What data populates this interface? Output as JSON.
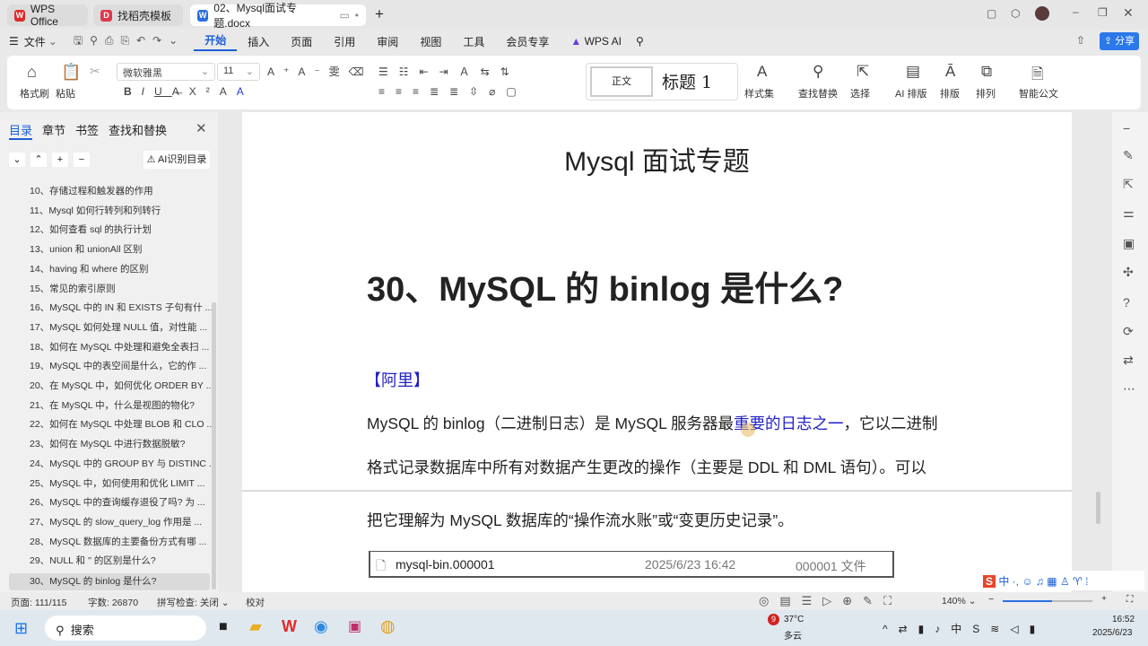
{
  "tabs": [
    {
      "label": "WPS Office"
    },
    {
      "label": "找稻壳模板"
    },
    {
      "label": "02、Mysql面试专题.docx"
    }
  ],
  "menu": {
    "file": "文件",
    "items": [
      "开始",
      "插入",
      "页面",
      "引用",
      "审阅",
      "视图",
      "工具",
      "会员专享",
      "WPS AI"
    ],
    "share": "分享"
  },
  "ribbon": {
    "format_painter": "格式刷",
    "paste": "粘贴",
    "font": "微软雅黑",
    "size": "11",
    "style_normal": "正文",
    "style_h1": "标题 1",
    "style_set": "样式集",
    "find_replace": "查找替换",
    "select": "选择",
    "ai_layout": "AI 排版",
    "layout": "排版",
    "arrange": "排列",
    "smart_doc": "智能公文"
  },
  "sidepane": {
    "tabs": [
      "目录",
      "章节",
      "书签",
      "查找和替换"
    ],
    "ai_toc": "AI识别目录",
    "items": [
      "10、存储过程和触发器的作用",
      "11、Mysql 如何行转列和列转行",
      "12、如何查看  sql  的执行计划",
      "13、union  和  unionAll  区别",
      "14、having 和 where 的区别",
      "15、常见的索引原则",
      "16、MySQL 中的 IN 和 EXISTS 子句有什 ...",
      "17、MySQL 如何处理 NULL 值，对性能 ...",
      "18、如何在 MySQL 中处理和避免全表扫 ...",
      "19、MySQL 中的表空间是什么，它的作 ...",
      "20、在 MySQL 中，如何优化 ORDER BY ...",
      "21、在 MySQL 中，什么是视图的物化?",
      "22、如何在 MySQL 中处理 BLOB 和 CLO ...",
      "23、如何在 MySQL 中进行数据脱敏?",
      "24、MySQL 中的 GROUP BY 与 DISTINC ...",
      "25、MySQL 中，如何使用和优化 LIMIT ...",
      "26、MySQL 中的查询缓存退役了吗? 为 ...",
      "27、MySQL 的 slow_query_log 作用是 ...",
      "28、MySQL  数据库的主要备份方式有哪 ...",
      "29、NULL  和  '' 的区别是什么?",
      "30、MySQL  的 binlog 是什么?"
    ]
  },
  "doc": {
    "title": "Mysql 面试专题",
    "heading": "30、MySQL  的 binlog 是什么?",
    "tag": "【阿里】",
    "line1a": "MySQL 的 binlog（二进制日志）是 MySQL 服务器最",
    "line1b": "重要的日志之一",
    "line1c": "，它以二进制",
    "line2": "格式记录数据库中所有对数据产生更改的操作（主要是 DDL 和 DML 语句）。可以",
    "line3": "把它理解为 MySQL 数据库的“操作流水账”或“变更历史记录”。",
    "file_name": "mysql-bin.000001",
    "file_date": "2025/6/23 16:42",
    "file_type": "000001 文件"
  },
  "status": {
    "page": "页面: 111/115",
    "words": "字数: 26870",
    "spell": "拼写检查: 关闭",
    "proof": "校对",
    "zoom": "140%",
    "zoom_level": 0.55
  },
  "taskbar": {
    "search": "搜索",
    "temp": "37°C",
    "weather": "多云",
    "badge": "9",
    "time": "16:52",
    "date": "2025/6/23"
  },
  "colors": {
    "accent": "#1a5fd8",
    "link": "#2020c8"
  }
}
